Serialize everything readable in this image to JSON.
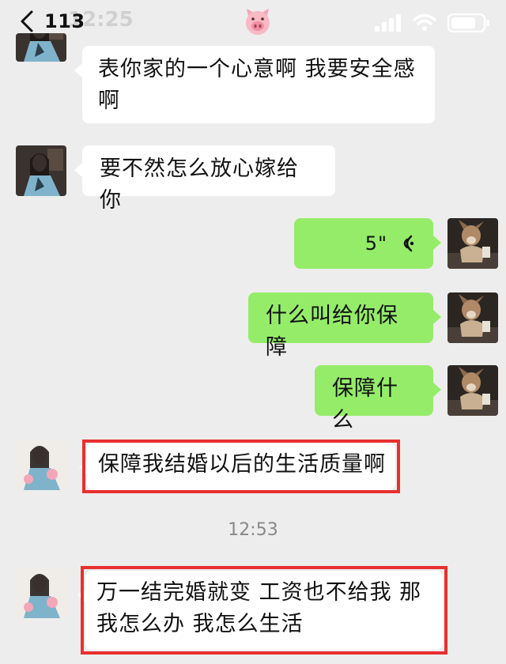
{
  "status_bar": {
    "back_count": "113",
    "time": "12:25",
    "contact_emoji": "pig-face"
  },
  "messages": [
    {
      "side": "left",
      "type": "text",
      "lines": [
        "表你家的一个心意啊  我要安全感",
        "啊"
      ]
    },
    {
      "side": "left",
      "type": "text",
      "text": "要不然怎么放心嫁给你"
    },
    {
      "side": "right",
      "type": "voice",
      "duration": "5\""
    },
    {
      "side": "right",
      "type": "text",
      "text": "什么叫给你保障"
    },
    {
      "side": "right",
      "type": "text",
      "text": "保障什么"
    },
    {
      "side": "left",
      "type": "text",
      "text": "保障我结婚以后的生活质量啊",
      "highlighted": true
    },
    {
      "side": "left",
      "type": "text",
      "lines": [
        "万一结完婚就变  工资也不给我  那",
        "我怎么办  我怎么生活"
      ],
      "highlighted": true
    }
  ],
  "timestamp": "12:53",
  "colors": {
    "background": "#ededed",
    "bubble_sent": "#95ec69",
    "bubble_received": "#ffffff",
    "highlight_box": "#e8302f"
  }
}
